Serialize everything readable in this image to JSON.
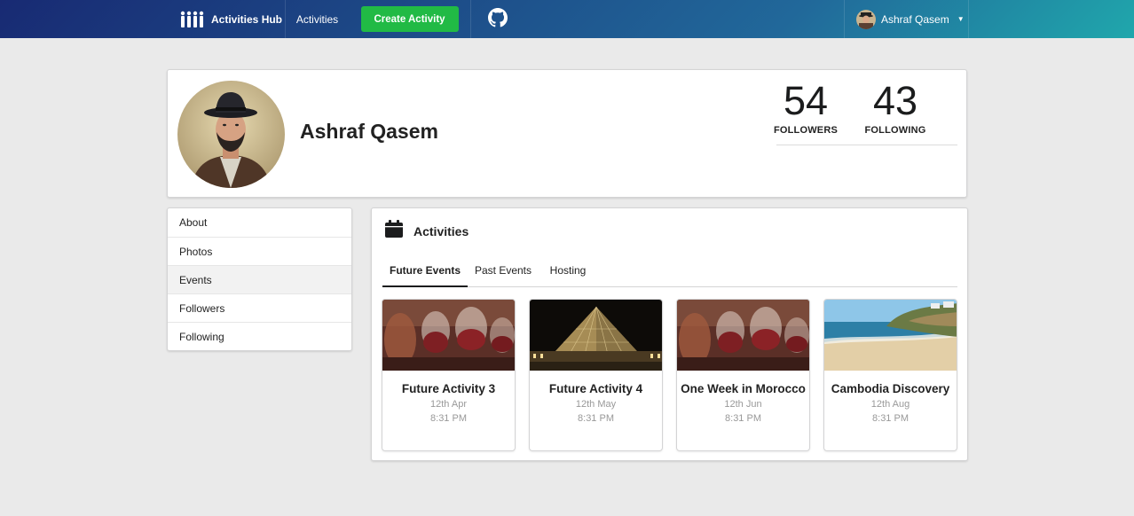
{
  "navbar": {
    "brand": "Activities Hub",
    "activities": "Activities",
    "create_activity": "Create Activity",
    "user_name": "Ashraf Qasem"
  },
  "profile": {
    "name": "Ashraf Qasem",
    "followers_count": "54",
    "followers_label": "FOLLOWERS",
    "following_count": "43",
    "following_label": "FOLLOWING"
  },
  "side_menu": {
    "items": [
      {
        "label": "About"
      },
      {
        "label": "Photos"
      },
      {
        "label": "Events"
      },
      {
        "label": "Followers"
      },
      {
        "label": "Following"
      }
    ],
    "active": "Events"
  },
  "activities": {
    "title": "Activities",
    "tabs": [
      {
        "label": "Future Events"
      },
      {
        "label": "Past Events"
      },
      {
        "label": "Hosting"
      }
    ],
    "active_tab": "Future Events",
    "cards": [
      {
        "title": "Future Activity 3",
        "date": "12th Apr",
        "time": "8:31 PM",
        "image": "drinks"
      },
      {
        "title": "Future Activity 4",
        "date": "12th May",
        "time": "8:31 PM",
        "image": "louvre-pyramid"
      },
      {
        "title": "One Week in Morocco",
        "date": "12th Jun",
        "time": "8:31 PM",
        "image": "drinks"
      },
      {
        "title": "Cambodia Discovery",
        "date": "12th Aug",
        "time": "8:31 PM",
        "image": "beach"
      }
    ]
  },
  "colors": {
    "navbar_start": "#182a73",
    "navbar_end": "#20a7ac",
    "create_button": "#21ba45",
    "page_background": "#eaeaea"
  }
}
